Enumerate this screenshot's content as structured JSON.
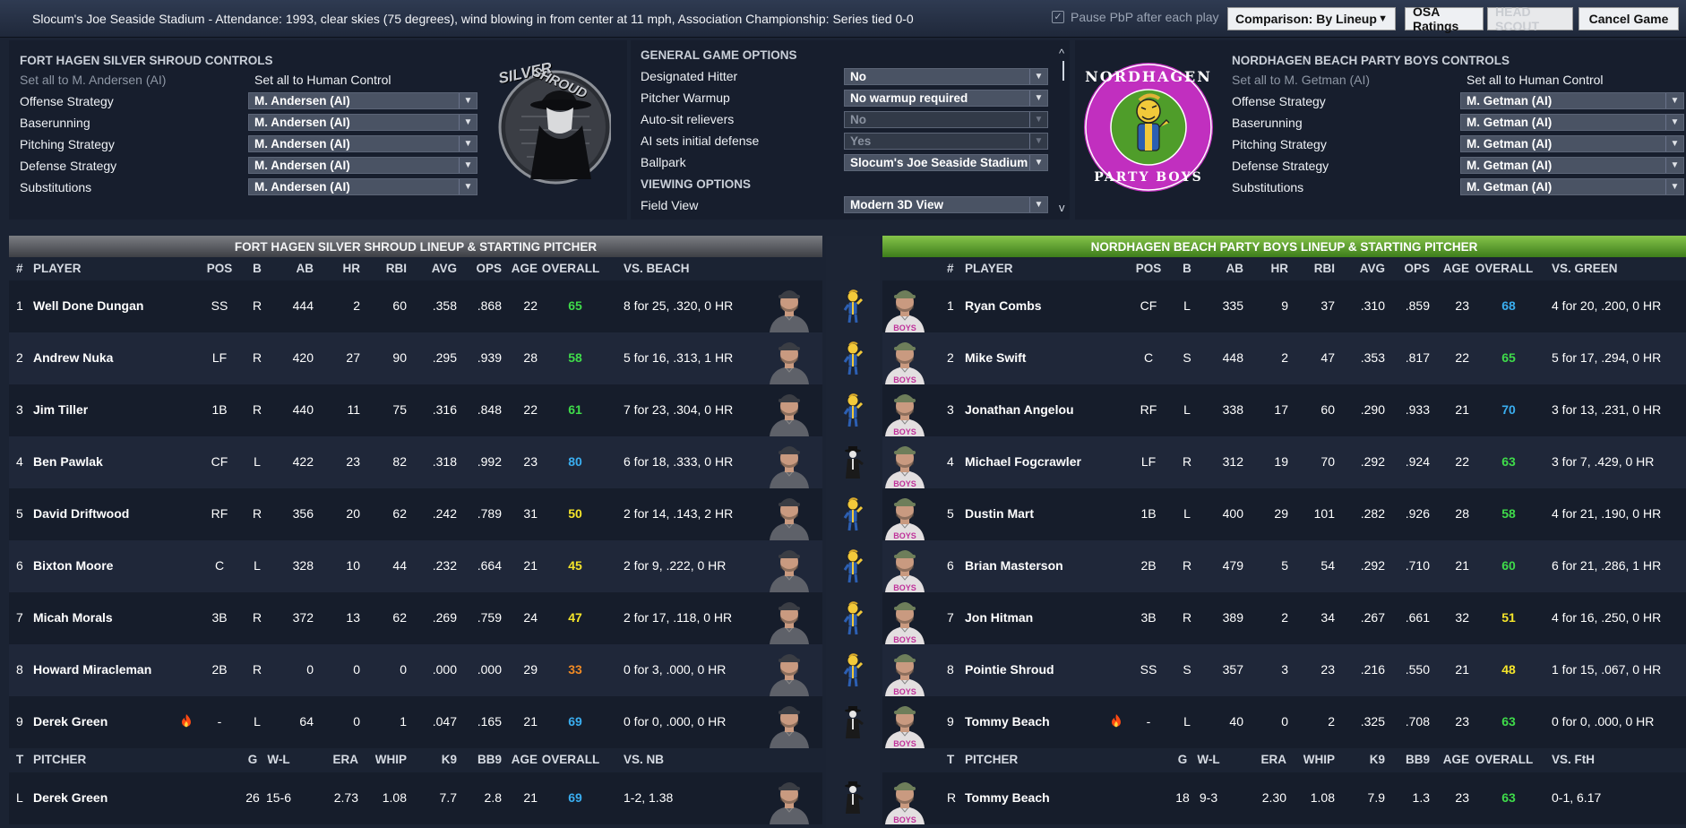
{
  "topbar": {
    "info": "Slocum's Joe Seaside Stadium - Attendance: 1993, clear skies (75  degrees), wind blowing in from center at 11 mph, Association Championship: Series tied 0-0",
    "pause_label": "Pause PbP after each play",
    "comparison_label": "Comparison: By Lineup",
    "osa_label": "OSA Ratings",
    "head_scout_label": "HEAD SCOUT",
    "cancel_label": "Cancel Game"
  },
  "left_controls": {
    "title": "FORT HAGEN SILVER SHROUD CONTROLS",
    "set_all_ai": "Set all to M. Andersen (AI)",
    "set_all_human": "Set all to Human Control",
    "rows": [
      {
        "label": "Offense Strategy",
        "value": "M. Andersen (AI)"
      },
      {
        "label": "Baserunning",
        "value": "M. Andersen (AI)"
      },
      {
        "label": "Pitching Strategy",
        "value": "M. Andersen (AI)"
      },
      {
        "label": "Defense Strategy",
        "value": "M. Andersen (AI)"
      },
      {
        "label": "Substitutions",
        "value": "M. Andersen (AI)"
      }
    ],
    "logo_text": [
      "SILVER",
      "SHROUD"
    ]
  },
  "general": {
    "title": "GENERAL GAME OPTIONS",
    "rows": [
      {
        "label": "Designated Hitter",
        "value": "No",
        "disabled": false
      },
      {
        "label": "Pitcher Warmup",
        "value": "No warmup required",
        "disabled": false
      },
      {
        "label": "Auto-sit relievers",
        "value": "No",
        "disabled": true
      },
      {
        "label": "AI sets initial defense",
        "value": "Yes",
        "disabled": true
      },
      {
        "label": "Ballpark",
        "value": "Slocum's Joe Seaside Stadium",
        "disabled": false
      }
    ],
    "viewing_title": "VIEWING OPTIONS",
    "field_view_label": "Field View",
    "field_view_value": "Modern 3D View"
  },
  "right_controls": {
    "title": "NORDHAGEN BEACH PARTY BOYS CONTROLS",
    "set_all_ai": "Set all to M. Getman (AI)",
    "set_all_human": "Set all to Human Control",
    "rows": [
      {
        "label": "Offense Strategy",
        "value": "M. Getman (AI)"
      },
      {
        "label": "Baserunning",
        "value": "M. Getman (AI)"
      },
      {
        "label": "Pitching Strategy",
        "value": "M. Getman (AI)"
      },
      {
        "label": "Defense Strategy",
        "value": "M. Getman (AI)"
      },
      {
        "label": "Substitutions",
        "value": "M. Getman (AI)"
      }
    ],
    "logo_text_top": "NORDHAGEN",
    "logo_text_bottom": "PARTY BOYS"
  },
  "left_lineup": {
    "title": "FORT HAGEN SILVER SHROUD LINEUP & STARTING PITCHER",
    "headers": {
      "num": "#",
      "player": "PLAYER",
      "pos": "POS",
      "b": "B",
      "ab": "AB",
      "hr": "HR",
      "rbi": "RBI",
      "avg": "AVG",
      "ops": "OPS",
      "age": "AGE",
      "overall": "OVERALL",
      "vs": "VS. BEACH"
    },
    "rows": [
      {
        "num": "1",
        "name": "Well Done Dungan",
        "pos": "SS",
        "b": "R",
        "ab": "444",
        "hr": "2",
        "rbi": "60",
        "avg": ".358",
        "ops": ".868",
        "age": "22",
        "overall": "65",
        "ovc": "#3fdc4a",
        "vs": "8 for 25, .320, 0 HR",
        "fire": false
      },
      {
        "num": "2",
        "name": "Andrew Nuka",
        "pos": "LF",
        "b": "R",
        "ab": "420",
        "hr": "27",
        "rbi": "90",
        "avg": ".295",
        "ops": ".939",
        "age": "28",
        "overall": "58",
        "ovc": "#3fdc4a",
        "vs": "5 for 16, .313, 1 HR",
        "fire": false
      },
      {
        "num": "3",
        "name": "Jim Tiller",
        "pos": "1B",
        "b": "R",
        "ab": "440",
        "hr": "11",
        "rbi": "75",
        "avg": ".316",
        "ops": ".848",
        "age": "22",
        "overall": "61",
        "ovc": "#3fdc4a",
        "vs": "7 for 23, .304, 0 HR",
        "fire": false
      },
      {
        "num": "4",
        "name": "Ben Pawlak",
        "pos": "CF",
        "b": "L",
        "ab": "422",
        "hr": "23",
        "rbi": "82",
        "avg": ".318",
        "ops": ".992",
        "age": "23",
        "overall": "80",
        "ovc": "#3aaef0",
        "vs": "6 for 18, .333, 0 HR",
        "fire": false
      },
      {
        "num": "5",
        "name": "David Driftwood",
        "pos": "RF",
        "b": "R",
        "ab": "356",
        "hr": "20",
        "rbi": "62",
        "avg": ".242",
        "ops": ".789",
        "age": "31",
        "overall": "50",
        "ovc": "#f5e52a",
        "vs": "2 for 14, .143, 2 HR",
        "fire": false
      },
      {
        "num": "6",
        "name": "Bixton Moore",
        "pos": "C",
        "b": "L",
        "ab": "328",
        "hr": "10",
        "rbi": "44",
        "avg": ".232",
        "ops": ".664",
        "age": "21",
        "overall": "45",
        "ovc": "#f5e52a",
        "vs": "2 for 9, .222, 0 HR",
        "fire": false
      },
      {
        "num": "7",
        "name": "Micah Morals",
        "pos": "3B",
        "b": "R",
        "ab": "372",
        "hr": "13",
        "rbi": "62",
        "avg": ".269",
        "ops": ".759",
        "age": "24",
        "overall": "47",
        "ovc": "#f5e52a",
        "vs": "2 for 17, .118, 0 HR",
        "fire": false
      },
      {
        "num": "8",
        "name": "Howard Miracleman",
        "pos": "2B",
        "b": "R",
        "ab": "0",
        "hr": "0",
        "rbi": "0",
        "avg": ".000",
        "ops": ".000",
        "age": "29",
        "overall": "33",
        "ovc": "#f08a24",
        "vs": "0 for 3, .000, 0 HR",
        "fire": false
      },
      {
        "num": "9",
        "name": "Derek Green",
        "pos": "-",
        "b": "L",
        "ab": "64",
        "hr": "0",
        "rbi": "1",
        "avg": ".047",
        "ops": ".165",
        "age": "21",
        "overall": "69",
        "ovc": "#3aaef0",
        "vs": "0 for 0, .000, 0 HR",
        "fire": true
      }
    ],
    "pitcher_headers": {
      "t": "T",
      "pitcher": "PITCHER",
      "g": "G",
      "wl": "W-L",
      "era": "ERA",
      "whip": "WHIP",
      "k9": "K9",
      "bb9": "BB9",
      "age": "AGE",
      "overall": "OVERALL",
      "vs": "VS. NB"
    },
    "pitcher": {
      "t": "L",
      "name": "Derek Green",
      "g": "26",
      "wl": "15-6",
      "era": "2.73",
      "whip": "1.08",
      "k9": "7.7",
      "bb9": "2.8",
      "age": "21",
      "overall": "69",
      "ovc": "#3aaef0",
      "vs": "1-2, 1.38"
    }
  },
  "right_lineup": {
    "title": "NORDHAGEN BEACH PARTY BOYS LINEUP & STARTING PITCHER",
    "headers": {
      "num": "#",
      "player": "PLAYER",
      "pos": "POS",
      "b": "B",
      "ab": "AB",
      "hr": "HR",
      "rbi": "RBI",
      "avg": "AVG",
      "ops": "OPS",
      "age": "AGE",
      "overall": "OVERALL",
      "vs": "VS. GREEN"
    },
    "rows": [
      {
        "num": "1",
        "name": "Ryan Combs",
        "pos": "CF",
        "b": "L",
        "ab": "335",
        "hr": "9",
        "rbi": "37",
        "avg": ".310",
        "ops": ".859",
        "age": "23",
        "overall": "68",
        "ovc": "#3aaef0",
        "vs": "4 for 20, .200, 0 HR",
        "fire": false
      },
      {
        "num": "2",
        "name": "Mike Swift",
        "pos": "C",
        "b": "S",
        "ab": "448",
        "hr": "2",
        "rbi": "47",
        "avg": ".353",
        "ops": ".817",
        "age": "22",
        "overall": "65",
        "ovc": "#3fdc4a",
        "vs": "5 for 17, .294, 0 HR",
        "fire": false
      },
      {
        "num": "3",
        "name": "Jonathan Angelou",
        "pos": "RF",
        "b": "L",
        "ab": "338",
        "hr": "17",
        "rbi": "60",
        "avg": ".290",
        "ops": ".933",
        "age": "21",
        "overall": "70",
        "ovc": "#3aaef0",
        "vs": "3 for 13, .231, 0 HR",
        "fire": false
      },
      {
        "num": "4",
        "name": "Michael Fogcrawler",
        "pos": "LF",
        "b": "R",
        "ab": "312",
        "hr": "19",
        "rbi": "70",
        "avg": ".292",
        "ops": ".924",
        "age": "22",
        "overall": "63",
        "ovc": "#3fdc4a",
        "vs": "3 for 7, .429, 0 HR",
        "fire": false
      },
      {
        "num": "5",
        "name": "Dustin Mart",
        "pos": "1B",
        "b": "L",
        "ab": "400",
        "hr": "29",
        "rbi": "101",
        "avg": ".282",
        "ops": ".926",
        "age": "28",
        "overall": "58",
        "ovc": "#3fdc4a",
        "vs": "4 for 21, .190, 0 HR",
        "fire": false
      },
      {
        "num": "6",
        "name": "Brian Masterson",
        "pos": "2B",
        "b": "R",
        "ab": "479",
        "hr": "5",
        "rbi": "54",
        "avg": ".292",
        "ops": ".710",
        "age": "21",
        "overall": "60",
        "ovc": "#3fdc4a",
        "vs": "6 for 21, .286, 1 HR",
        "fire": false
      },
      {
        "num": "7",
        "name": "Jon Hitman",
        "pos": "3B",
        "b": "R",
        "ab": "389",
        "hr": "2",
        "rbi": "34",
        "avg": ".267",
        "ops": ".661",
        "age": "32",
        "overall": "51",
        "ovc": "#f5e52a",
        "vs": "4 for 16, .250, 0 HR",
        "fire": false
      },
      {
        "num": "8",
        "name": "Pointie Shroud",
        "pos": "SS",
        "b": "S",
        "ab": "357",
        "hr": "3",
        "rbi": "23",
        "avg": ".216",
        "ops": ".550",
        "age": "21",
        "overall": "48",
        "ovc": "#f5e52a",
        "vs": "1 for 15, .067, 0 HR",
        "fire": false
      },
      {
        "num": "9",
        "name": "Tommy Beach",
        "pos": "-",
        "b": "L",
        "ab": "40",
        "hr": "0",
        "rbi": "2",
        "avg": ".325",
        "ops": ".708",
        "age": "23",
        "overall": "63",
        "ovc": "#3fdc4a",
        "vs": "0 for 0, .000, 0 HR",
        "fire": true
      }
    ],
    "pitcher_headers": {
      "t": "T",
      "pitcher": "PITCHER",
      "g": "G",
      "wl": "W-L",
      "era": "ERA",
      "whip": "WHIP",
      "k9": "K9",
      "bb9": "BB9",
      "age": "AGE",
      "overall": "OVERALL",
      "vs": "VS. FtH"
    },
    "pitcher": {
      "t": "R",
      "name": "Tommy Beach",
      "g": "18",
      "wl": "9-3",
      "era": "2.30",
      "whip": "1.08",
      "k9": "7.9",
      "bb9": "1.3",
      "age": "23",
      "overall": "63",
      "ovc": "#3fdc4a",
      "vs": "0-1, 6.17"
    }
  },
  "mid_icons": [
    "vault-boy-icon",
    "vault-boy-icon",
    "vault-boy-icon",
    "shroud-figure-icon",
    "vault-boy-icon",
    "vault-boy-icon",
    "vault-boy-icon",
    "vault-boy-icon",
    "shroud-figure-icon",
    "shroud-figure-icon"
  ],
  "colors": {
    "green": "#3fdc4a",
    "blue": "#3aaef0",
    "yellow": "#f5e52a",
    "orange": "#f08a24",
    "right_header": "#6aaa32"
  }
}
